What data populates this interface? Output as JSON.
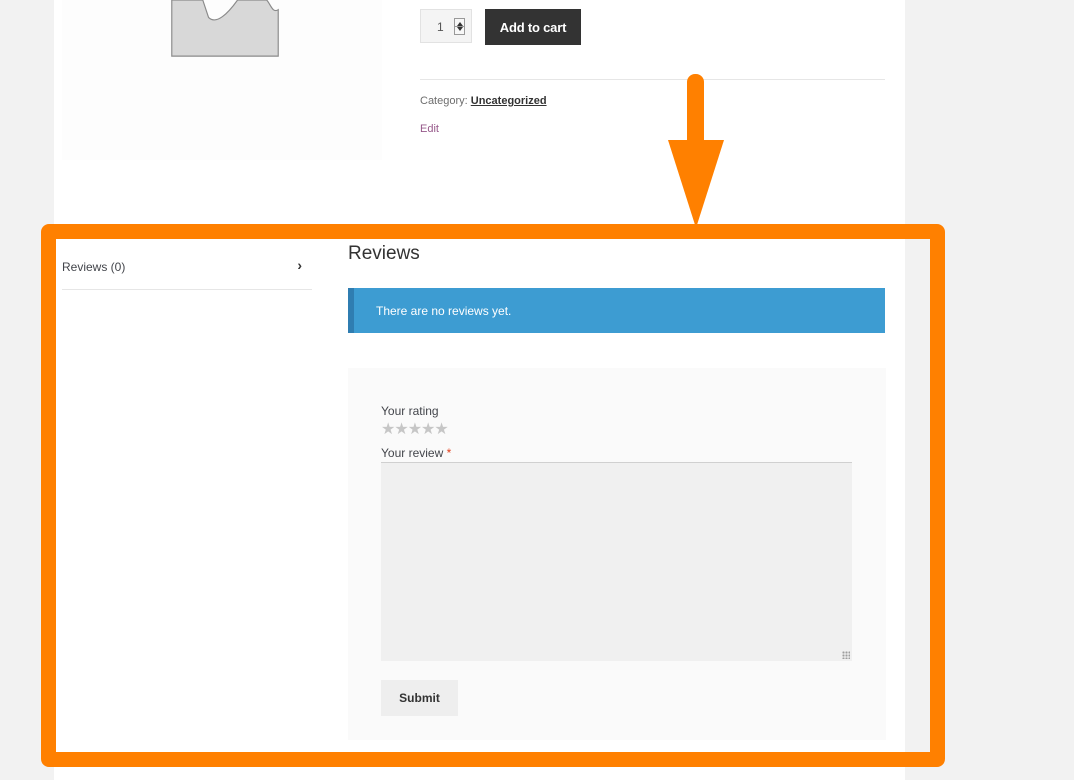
{
  "product": {
    "quantity": "1",
    "add_to_cart_label": "Add to cart",
    "category_label": "Category:",
    "category_value": "Uncategorized",
    "edit_label": "Edit"
  },
  "tabs": [
    {
      "label": "Reviews (0)"
    }
  ],
  "reviews": {
    "heading": "Reviews",
    "notice": "There are no reviews yet.",
    "rating_label": "Your rating",
    "stars_count": 5,
    "review_label": "Your review",
    "required_mark": "*",
    "submit_label": "Submit"
  },
  "colors": {
    "highlight": "#ff8000",
    "notice_bg": "#3d9cd2",
    "button_dark": "#333333"
  }
}
